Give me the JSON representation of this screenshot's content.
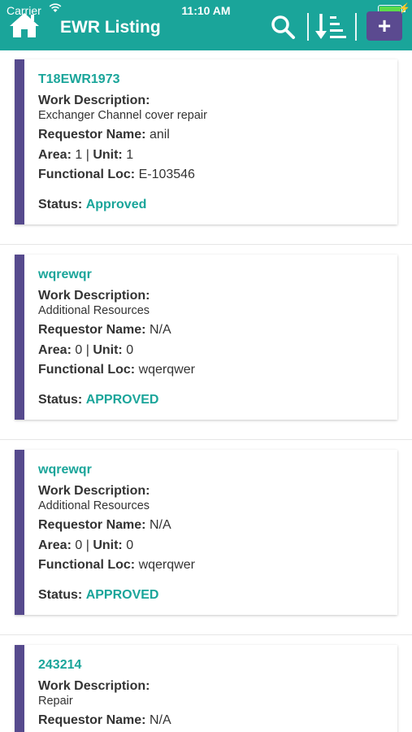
{
  "status_bar": {
    "carrier": "Carrier",
    "time": "11:10 AM"
  },
  "header": {
    "title": "EWR Listing",
    "home_icon": "home-icon",
    "search_icon": "search-icon",
    "sort_icon": "sort-icon",
    "add_icon": "plus-icon"
  },
  "labels": {
    "work_description": "Work Description:",
    "requestor_name": "Requestor Name:",
    "area": "Area:",
    "unit": "Unit:",
    "functional_loc": "Functional Loc:",
    "status": "Status:",
    "separator": "|"
  },
  "records": [
    {
      "id": "T18EWR1973",
      "work_description": "Exchanger Channel cover repair",
      "requestor_name": "anil",
      "area": "1",
      "unit": "1",
      "functional_loc": "E-103546",
      "status": "Approved"
    },
    {
      "id": "wqrewqr",
      "work_description": "Additional Resources",
      "requestor_name": "N/A",
      "area": "0",
      "unit": "0",
      "functional_loc": "wqerqwer",
      "status": "APPROVED"
    },
    {
      "id": "wqrewqr",
      "work_description": "Additional Resources",
      "requestor_name": "N/A",
      "area": "0",
      "unit": "0",
      "functional_loc": "wqerqwer",
      "status": "APPROVED"
    },
    {
      "id": "243214",
      "work_description": "Repair",
      "requestor_name": "N/A"
    }
  ],
  "colors": {
    "header_bg": "#1aa59a",
    "accent_bar": "#564a8d",
    "add_button": "#5b4a90",
    "status_text": "#1aa59a"
  }
}
